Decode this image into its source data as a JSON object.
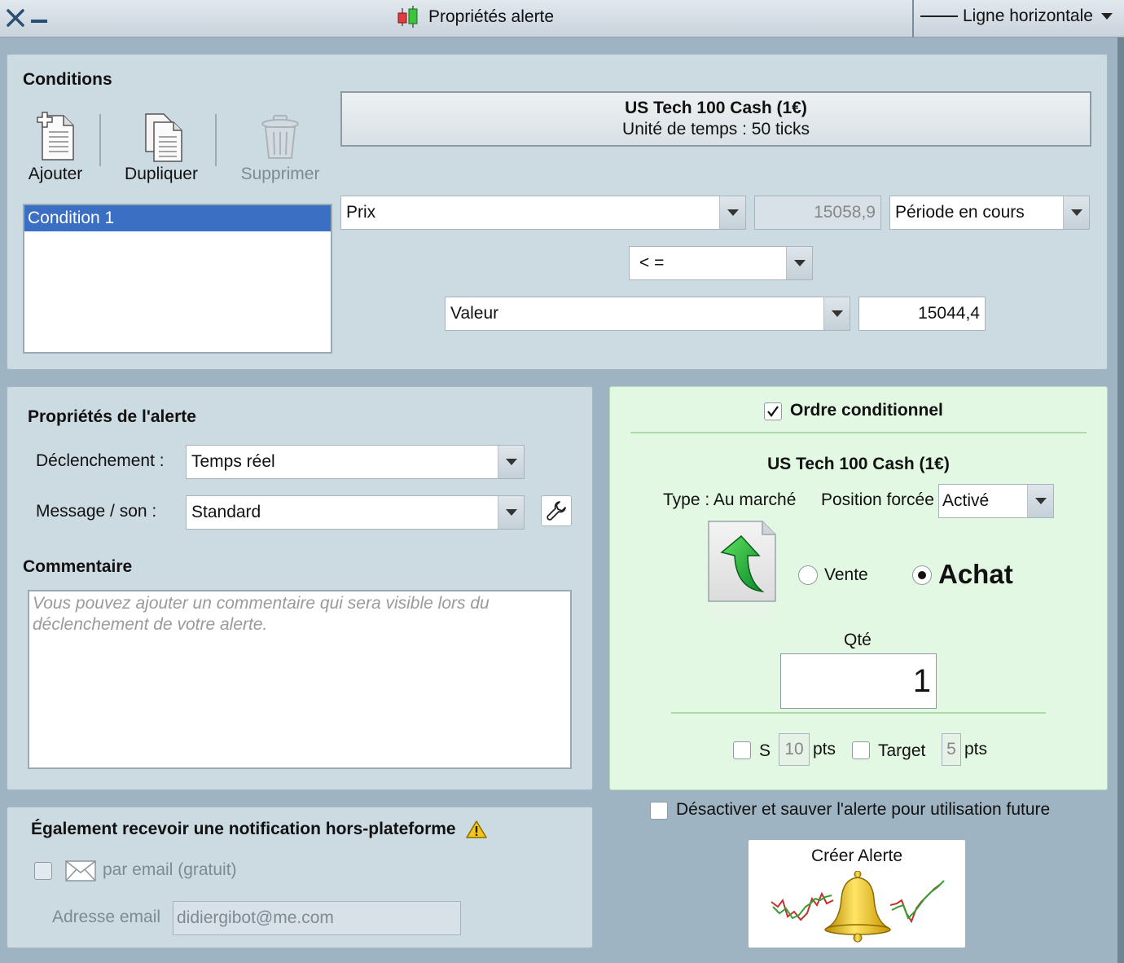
{
  "titlebar": {
    "title": "Propriétés alerte",
    "drawing_tool": "Ligne horizontale"
  },
  "conditions": {
    "heading": "Conditions",
    "toolbar": {
      "add_label": "Ajouter",
      "duplicate_label": "Dupliquer",
      "delete_label": "Supprimer"
    },
    "list": [
      "Condition 1"
    ],
    "instrument": {
      "name": "US Tech 100 Cash (1€)",
      "timeframe": "Unité de temps : 50 ticks"
    },
    "left_operand": "Prix",
    "current_price": "15058,9",
    "period": "Période en cours",
    "operator": "< =",
    "right_operand": "Valeur",
    "right_value": "15044,4"
  },
  "alert_props": {
    "heading": "Propriétés de l'alerte",
    "trigger_label": "Déclenchement :",
    "trigger_value": "Temps réel",
    "message_label": "Message / son :",
    "message_value": "Standard",
    "comment_heading": "Commentaire",
    "comment_placeholder": "Vous pouvez ajouter un commentaire qui sera visible lors du déclenchement de votre alerte."
  },
  "notification": {
    "heading": "Également recevoir une notification hors-plateforme",
    "email_label": "par email (gratuit)",
    "email_checked": false,
    "address_label": "Adresse email",
    "address_value": "didiergibot@me.com"
  },
  "order": {
    "enabled_label": "Ordre conditionnel",
    "enabled": true,
    "instrument": "US Tech 100 Cash (1€)",
    "type_label": "Type : Au marché",
    "forced_label": "Position forcée",
    "forced_value": "Activé",
    "sell_label": "Vente",
    "buy_label": "Achat",
    "side": "buy",
    "qty_label": "Qté",
    "qty_value": "1",
    "stop_label": "S",
    "stop_value": "10",
    "stop_unit": "pts",
    "target_label": "Target",
    "target_value": "5",
    "target_unit": "pts"
  },
  "footer": {
    "disable_label": "Désactiver et sauver l'alerte pour utilisation future",
    "create_label": "Créer Alerte"
  }
}
